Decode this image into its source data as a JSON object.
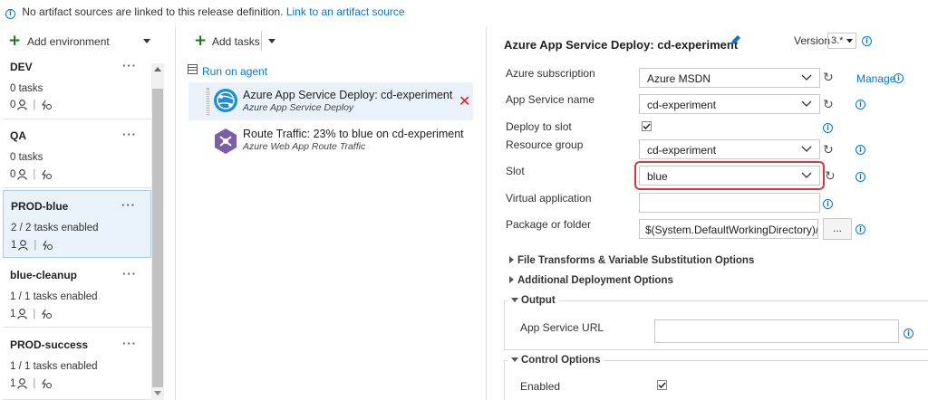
{
  "notice": {
    "text": "No artifact sources are linked to this release definition.",
    "link": "Link to an artifact source"
  },
  "environments": {
    "add_label": "Add environment",
    "items": [
      {
        "name": "DEV",
        "tasks": "0 tasks",
        "approvers": "0"
      },
      {
        "name": "QA",
        "tasks": "0 tasks",
        "approvers": "0"
      },
      {
        "name": "PROD-blue",
        "tasks": "2 / 2 tasks enabled",
        "approvers": "1"
      },
      {
        "name": "blue-cleanup",
        "tasks": "1 / 1 tasks enabled",
        "approvers": "1"
      },
      {
        "name": "PROD-success",
        "tasks": "1 / 1 tasks enabled",
        "approvers": "1"
      }
    ],
    "more": "···"
  },
  "tasks": {
    "add_label": "Add tasks",
    "phase_label": "Run on agent",
    "items": [
      {
        "title": "Azure App Service Deploy: cd-experiment",
        "subtitle": "Azure App Service Deploy"
      },
      {
        "title": "Route Traffic: 23% to blue on cd-experiment",
        "subtitle": "Azure Web App Route Traffic"
      }
    ]
  },
  "detail": {
    "title": "Azure App Service Deploy: cd-experiment",
    "version_label": "Version",
    "version_value": "3.*",
    "manage_label": "Manage",
    "fields": {
      "subscription_label": "Azure subscription",
      "subscription_value": "Azure MSDN",
      "app_service_label": "App Service name",
      "app_service_value": "cd-experiment",
      "deploy_slot_label": "Deploy to slot",
      "resource_group_label": "Resource group",
      "resource_group_value": "cd-experiment",
      "slot_label": "Slot",
      "slot_value": "blue",
      "virtual_app_label": "Virtual application",
      "virtual_app_value": "",
      "package_label": "Package or folder",
      "package_value": "$(System.DefaultWorkingDirectory)/*",
      "browse_label": "..."
    },
    "sections": {
      "file_transforms": "File Transforms & Variable Substitution Options",
      "additional_deploy": "Additional Deployment Options",
      "output": "Output",
      "app_service_url_label": "App Service URL",
      "control_options": "Control Options",
      "enabled_label": "Enabled"
    }
  },
  "colors": {
    "accent": "#0078d4",
    "add_green": "#107c10",
    "delete_red": "#e81123",
    "highlight_red": "#d9363e",
    "selected_bg": "#e9f2f9"
  }
}
